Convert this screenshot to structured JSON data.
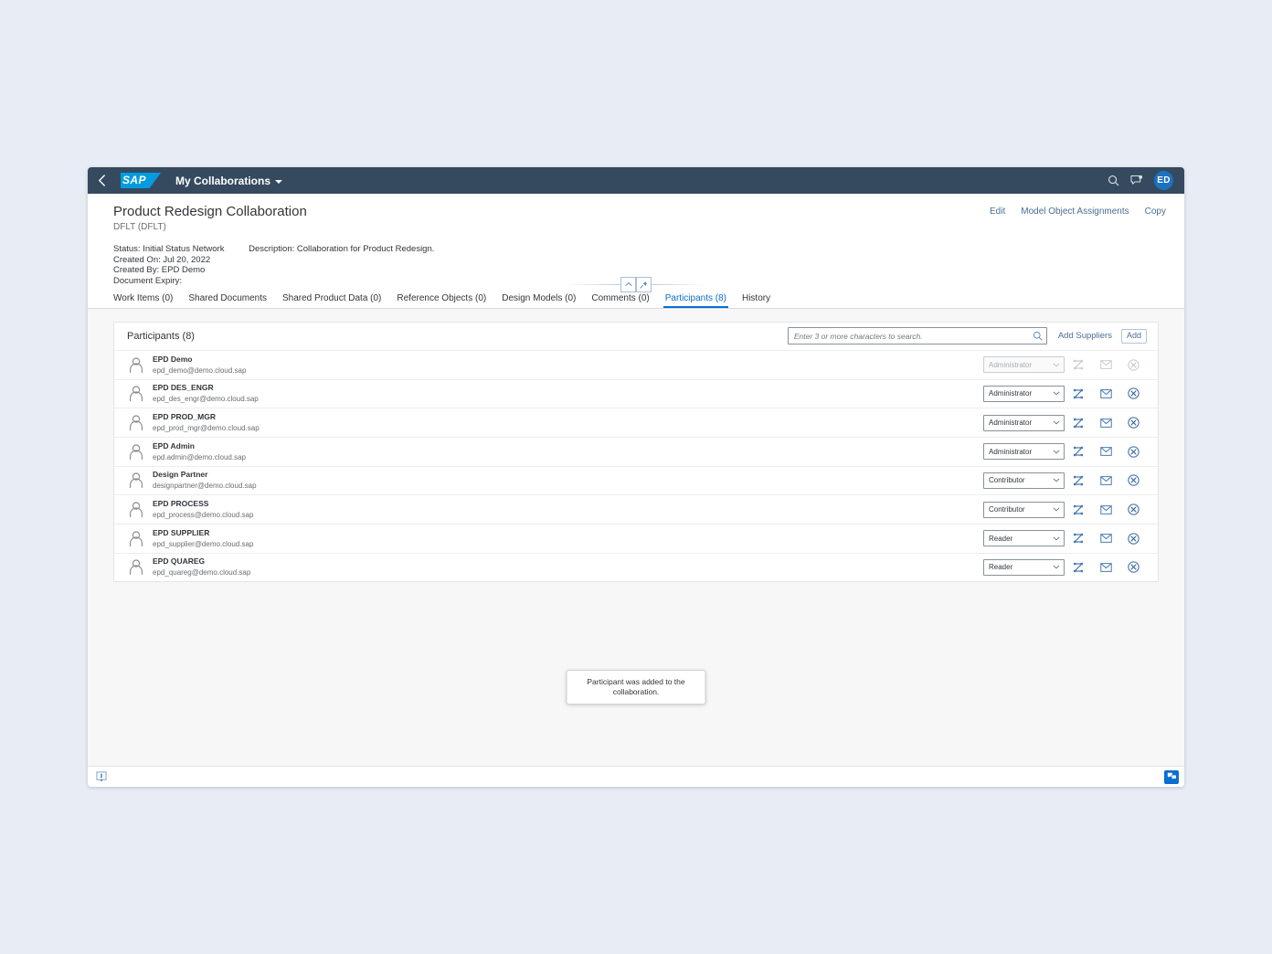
{
  "shellbar": {
    "back_icon": "chevron-left-icon",
    "logo_text": "SAP",
    "app_title": "My Collaborations",
    "search_icon": "search-icon",
    "notifications_icon": "feedback-icon",
    "avatar_initials": "ED"
  },
  "object_header": {
    "title": "Product Redesign Collaboration",
    "subtitle": "DFLT (DFLT)",
    "status_line": "Status: Initial Status Network",
    "description_line": "Description: Collaboration for Product Redesign.",
    "created_on_line": "Created On: Jul 20, 2022",
    "created_by_line": "Created By: EPD Demo",
    "document_expiry_line": "Document Expiry:",
    "actions": [
      {
        "label": "Edit",
        "name": "edit-action"
      },
      {
        "label": "Model Object Assignments",
        "name": "model-object-assignments-action"
      },
      {
        "label": "Copy",
        "name": "copy-action"
      }
    ],
    "collapse_icon": "chevron-up-icon",
    "pin_icon": "pin-icon"
  },
  "tabs": [
    {
      "label": "Work Items (0)",
      "name": "tab-work-items",
      "selected": false
    },
    {
      "label": "Shared Documents",
      "name": "tab-shared-documents",
      "selected": false
    },
    {
      "label": "Shared Product Data (0)",
      "name": "tab-shared-product-data",
      "selected": false
    },
    {
      "label": "Reference Objects (0)",
      "name": "tab-reference-objects",
      "selected": false
    },
    {
      "label": "Design Models (0)",
      "name": "tab-design-models",
      "selected": false
    },
    {
      "label": "Comments (0)",
      "name": "tab-comments",
      "selected": false
    },
    {
      "label": "Participants (8)",
      "name": "tab-participants",
      "selected": true
    },
    {
      "label": "History",
      "name": "tab-history",
      "selected": false
    }
  ],
  "participants_panel": {
    "title": "Participants (8)",
    "search_placeholder": "Enter 3 or more characters to search.",
    "search_value": "",
    "search_icon": "search-icon",
    "add_suppliers_label": "Add Suppliers",
    "add_label": "Add",
    "role_options": [
      "Administrator",
      "Contributor",
      "Reader"
    ],
    "row_icons": {
      "status_icon": "workflow-tasks-icon",
      "email_icon": "envelope-icon",
      "remove_icon": "circle-x-icon"
    },
    "rows": [
      {
        "name": "EPD Demo",
        "email": "epd_demo@demo.cloud.sap",
        "role": "Administrator",
        "disabled": true,
        "avatar_icon": "person-avatar-icon"
      },
      {
        "name": "EPD DES_ENGR",
        "email": "epd_des_engr@demo.cloud.sap",
        "role": "Administrator",
        "disabled": false,
        "avatar_icon": "person-avatar-icon"
      },
      {
        "name": "EPD PROD_MGR",
        "email": "epd_prod_mgr@demo.cloud.sap",
        "role": "Administrator",
        "disabled": false,
        "avatar_icon": "person-avatar-icon"
      },
      {
        "name": "EPD Admin",
        "email": "epd.admin@demo.cloud.sap",
        "role": "Administrator",
        "disabled": false,
        "avatar_icon": "person-avatar-icon"
      },
      {
        "name": "Design Partner",
        "email": "designpartner@demo.cloud.sap",
        "role": "Contributor",
        "disabled": false,
        "avatar_icon": "person-avatar-icon"
      },
      {
        "name": "EPD PROCESS",
        "email": "epd_process@demo.cloud.sap",
        "role": "Contributor",
        "disabled": false,
        "avatar_icon": "person-avatar-icon"
      },
      {
        "name": "EPD SUPPLIER",
        "email": "epd_supplier@demo.cloud.sap",
        "role": "Reader",
        "disabled": false,
        "avatar_icon": "person-avatar-icon"
      },
      {
        "name": "EPD QUAREG",
        "email": "epd_quareg@demo.cloud.sap",
        "role": "Reader",
        "disabled": false,
        "avatar_icon": "person-avatar-icon"
      }
    ]
  },
  "toast": {
    "message": "Participant was added to the collaboration."
  },
  "footer": {
    "left_icon": "message-popover-icon",
    "right_icon": "feedback-icon"
  },
  "colors": {
    "shellbar_bg": "#354a5f",
    "accent": "#0a6ed1",
    "logo_blue": "#019ce0",
    "page_bg": "#e8edf5",
    "content_bg": "#f7f7f7",
    "link": "#4a6d93",
    "text": "#32363a",
    "muted_text": "#6a6d70"
  }
}
